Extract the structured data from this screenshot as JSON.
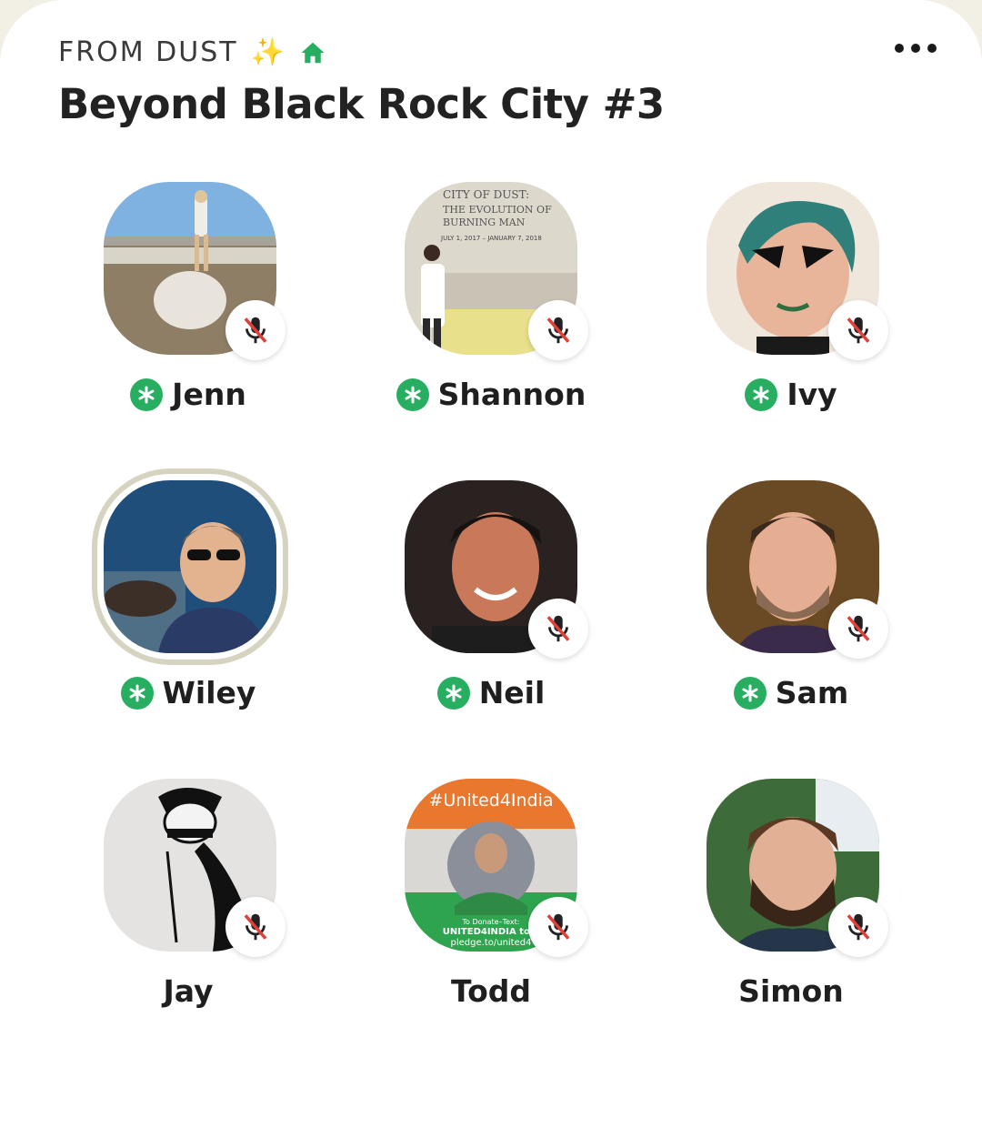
{
  "room": {
    "club_name": "FROM DUST",
    "sparkle_icon": "sparkles-icon",
    "house_icon": "house-icon",
    "title": "Beyond Black Rock City #3",
    "more_icon": "ellipsis-icon"
  },
  "colors": {
    "moderator_green": "#27ae60",
    "muted_red": "#e0403a",
    "speaking_ring": "#d7d3c1",
    "card_bg": "#ffffff"
  },
  "speakers": [
    {
      "name": "Jenn",
      "moderator": true,
      "muted": true,
      "speaking": false
    },
    {
      "name": "Shannon",
      "moderator": true,
      "muted": true,
      "speaking": false
    },
    {
      "name": "Ivy",
      "moderator": true,
      "muted": true,
      "speaking": false
    },
    {
      "name": "Wiley",
      "moderator": true,
      "muted": false,
      "speaking": true
    },
    {
      "name": "Neil",
      "moderator": true,
      "muted": true,
      "speaking": false
    },
    {
      "name": "Sam",
      "moderator": true,
      "muted": true,
      "speaking": false
    },
    {
      "name": "Jay",
      "moderator": false,
      "muted": true,
      "speaking": false
    },
    {
      "name": "Todd",
      "moderator": false,
      "muted": true,
      "speaking": false
    },
    {
      "name": "Simon",
      "moderator": false,
      "muted": true,
      "speaking": false
    }
  ],
  "avatar_art": {
    "jenn": {
      "caption": ""
    },
    "shannon": {
      "poster_line1": "CITY OF DUST:",
      "poster_line2": "THE EVOLUTION OF",
      "poster_line3": "BURNING MAN",
      "poster_dates": "JULY 1, 2017 – JANUARY 7, 2018"
    },
    "todd": {
      "banner": "#United4India",
      "donate_line1": "To Donate–Text:",
      "donate_line2": "UNITED4INDIA to 7",
      "donate_line3": "pledge.to/united4"
    }
  }
}
